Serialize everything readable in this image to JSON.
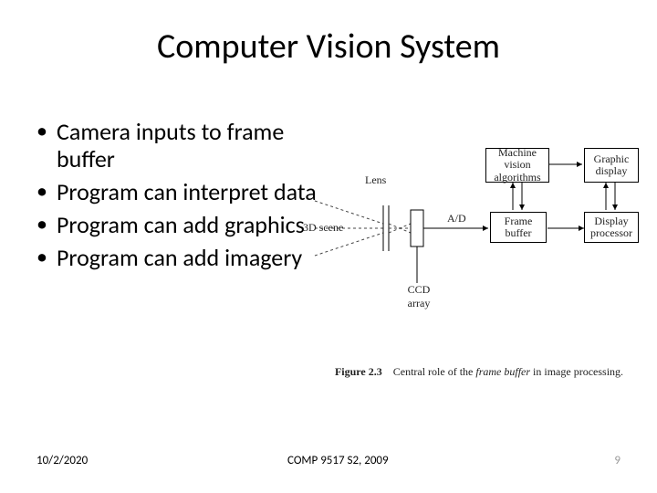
{
  "title": "Computer Vision System",
  "bullets": [
    "Camera inputs to frame buffer",
    "Program can interpret data",
    "Program can add graphics",
    "Program can add imagery"
  ],
  "diagram": {
    "scene_label": "3D scene",
    "lens_label": "Lens",
    "ccd_label": "CCD array",
    "ad_label": "A/D",
    "frame_buffer": "Frame buffer",
    "algorithms": "Machine vision algorithms",
    "display_processor": "Display processor",
    "graphic_display": "Graphic display",
    "caption_prefix": "Figure 2.3",
    "caption_text1": "Central role of the ",
    "caption_italic": "frame buffer",
    "caption_text2": " in image processing."
  },
  "footer": {
    "date": "10/2/2020",
    "course": "COMP 9517 S2, 2009",
    "page": "9"
  }
}
